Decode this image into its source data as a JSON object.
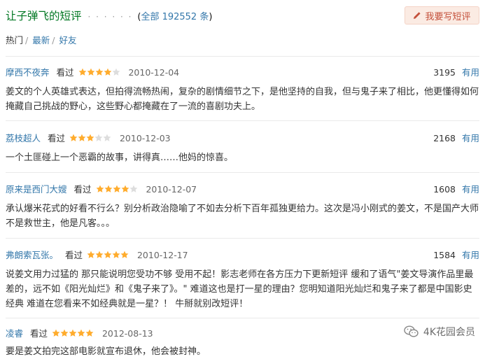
{
  "header": {
    "title": "让子弹飞的短评",
    "dots": "· · · · · ·",
    "total_open": "(",
    "total_label": "全部 192552 条",
    "total_close": ")",
    "write_button": "我要写短评"
  },
  "tabs": [
    {
      "label": "热门",
      "active": true
    },
    {
      "label": "最新",
      "active": false
    },
    {
      "label": "好友",
      "active": false
    }
  ],
  "tab_separator": "/",
  "reviews": [
    {
      "author": "摩西不夜奔",
      "status": "看过",
      "rating": 4,
      "date": "2010-12-04",
      "votes": "3195",
      "useful_label": "有用",
      "text": "姜文的个人英雄式表达，但拍得流畅热闹，复杂的剧情细节之下，是他坚持的自我，但与鬼子来了相比，他更懂得如何掩藏自己挑战的野心，这些野心都掩藏在了一流的喜剧功夫上。"
    },
    {
      "author": "荔枝超人",
      "status": "看过",
      "rating": 3,
      "date": "2010-12-03",
      "votes": "2168",
      "useful_label": "有用",
      "text": "一个土匪碰上一个恶霸的故事，讲得真……他妈的惊喜。"
    },
    {
      "author": "原来是西门大嫂",
      "status": "看过",
      "rating": 4,
      "date": "2010-12-07",
      "votes": "1608",
      "useful_label": "有用",
      "text": "承认爆米花式的好看不行么？别分析政治隐喻了不如去分析下百年孤独更给力。这次是冯小刚式的姜文，不是国产大师不是救世主，他是凡客。。。"
    },
    {
      "author": "弗朗索瓦张。",
      "status": "看过",
      "rating": 5,
      "date": "2010-12-17",
      "votes": "1584",
      "useful_label": "有用",
      "text": "说姜文用力过猛的 那只能说明您受功不够 受用不起！影志老师在各方压力下更新短评 缓和了语气\"姜文导演作品里最差的，远不如《阳光灿烂》和《鬼子来了》。\" 难道这也是打一星的理由？您明知道阳光灿烂和鬼子来了都是中国影史经典 难道在您看来不如经典就是一星？！ 牛掰就别改短评！"
    },
    {
      "author": "凌睿",
      "status": "看过",
      "rating": 5,
      "date": "2012-08-13",
      "votes": "",
      "useful_label": "",
      "text": "要是姜文拍完这部电影就宣布退休，他会被封神。"
    }
  ],
  "watermark": {
    "text": "4K花园会员",
    "icon": "wechat-icon"
  },
  "colors": {
    "title": "#007722",
    "link": "#3377aa",
    "star": "#ffac2d",
    "button_bg": "#fbebe3",
    "button_text": "#c4503b"
  }
}
